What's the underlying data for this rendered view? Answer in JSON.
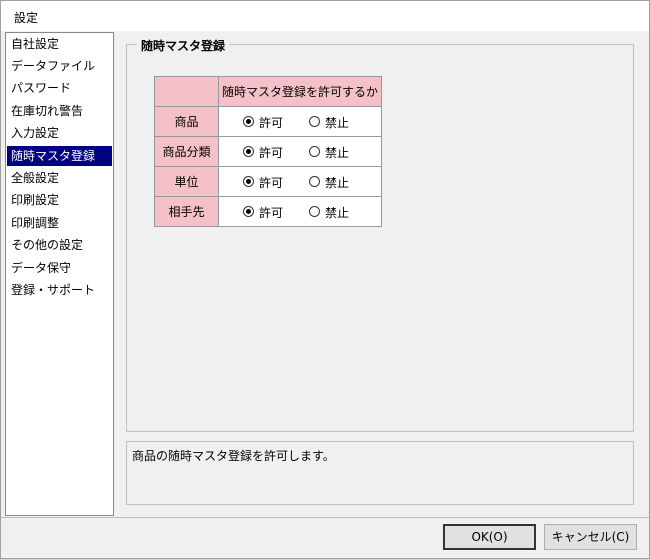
{
  "window": {
    "title": "設定"
  },
  "sidebar": {
    "items": [
      {
        "label": "自社設定"
      },
      {
        "label": "データファイル"
      },
      {
        "label": "パスワード"
      },
      {
        "label": "在庫切れ警告"
      },
      {
        "label": "入力設定"
      },
      {
        "label": "随時マスタ登録",
        "selected": true
      },
      {
        "label": "全般設定"
      },
      {
        "label": "印刷設定"
      },
      {
        "label": "印刷調整"
      },
      {
        "label": "その他の設定"
      },
      {
        "label": "データ保守"
      },
      {
        "label": "登録・サポート"
      }
    ]
  },
  "group": {
    "legend": "随時マスタ登録",
    "table": {
      "header": "随時マスタ登録を許可するか",
      "rows": [
        {
          "label": "商品",
          "allow": "許可",
          "deny": "禁止",
          "selected": "allow"
        },
        {
          "label": "商品分類",
          "allow": "許可",
          "deny": "禁止",
          "selected": "allow"
        },
        {
          "label": "単位",
          "allow": "許可",
          "deny": "禁止",
          "selected": "allow"
        },
        {
          "label": "相手先",
          "allow": "許可",
          "deny": "禁止",
          "selected": "allow"
        }
      ]
    }
  },
  "description": "商品の随時マスタ登録を許可します。",
  "buttons": {
    "ok": "OK(O)",
    "cancel": "キャンセル(C)"
  },
  "colors": {
    "selection": "#000080",
    "header_fill": "#f5c1c8"
  }
}
